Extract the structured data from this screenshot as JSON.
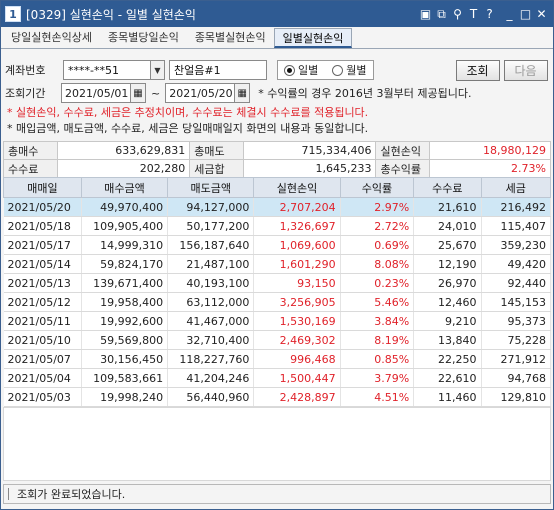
{
  "window": {
    "num": "1",
    "title": "[0329] 실현손익 - 일별 실현손익",
    "icons": [
      "window-icon",
      "copy-icon",
      "pin-icon",
      "font-size-icon",
      "help-icon",
      "minimize-icon",
      "maximize-icon",
      "close-icon"
    ],
    "icon_glyphs": [
      "▣",
      "⧉",
      "⚲",
      "T",
      "?",
      "_",
      "□",
      "✕"
    ]
  },
  "tabs": [
    {
      "label": "당일실현손익상세",
      "active": false
    },
    {
      "label": "종목별당일손익",
      "active": false
    },
    {
      "label": "종목별실현손익",
      "active": false
    },
    {
      "label": "일별실현손익",
      "active": true
    }
  ],
  "controls": {
    "account_label": "계좌번호",
    "account_value": "****-**51",
    "account_name": "찬얼음#1",
    "radio_daily": "일별",
    "radio_monthly": "월별",
    "radio_selected": "daily",
    "query_button": "조회",
    "next_button": "다음",
    "period_label": "조회기간",
    "date_from": "2021/05/01",
    "tilde": "~",
    "date_to": "2021/05/20",
    "period_note": "* 수익률의 경우 2016년 3월부터 제공됩니다."
  },
  "notes": {
    "red": "* 실현손익, 수수료, 세금은 추정치이며, 수수료는 체결시 수수료를 적용됩니다.",
    "black": "* 매입금액, 매도금액, 수수료, 세금은 당일매매일지 화면의 내용과 동일합니다."
  },
  "summary": {
    "row1": [
      {
        "key": "총매수",
        "value": "633,629,831"
      },
      {
        "key": "총매도",
        "value": "715,334,406"
      },
      {
        "key": "실현손익",
        "value": "18,980,129",
        "color": "#e0222a"
      }
    ],
    "row2": [
      {
        "key": "수수료",
        "value": "202,280"
      },
      {
        "key": "세금합",
        "value": "1,645,233"
      },
      {
        "key": "총수익률",
        "value": "2.73%",
        "color": "#e0222a"
      }
    ]
  },
  "table": {
    "headers": [
      "매매일",
      "매수금액",
      "매도금액",
      "실현손익",
      "수익률",
      "수수료",
      "세금"
    ],
    "rows": [
      [
        "2021/05/20",
        "49,970,400",
        "94,127,000",
        "2,707,204",
        "2.97%",
        "21,610",
        "216,492"
      ],
      [
        "2021/05/18",
        "109,905,400",
        "50,177,200",
        "1,326,697",
        "2.72%",
        "24,010",
        "115,407"
      ],
      [
        "2021/05/17",
        "14,999,310",
        "156,187,640",
        "1,069,600",
        "0.69%",
        "25,670",
        "359,230"
      ],
      [
        "2021/05/14",
        "59,824,170",
        "21,487,100",
        "1,601,290",
        "8.08%",
        "12,190",
        "49,420"
      ],
      [
        "2021/05/13",
        "139,671,400",
        "40,193,100",
        "93,150",
        "0.23%",
        "26,970",
        "92,440"
      ],
      [
        "2021/05/12",
        "19,958,400",
        "63,112,000",
        "3,256,905",
        "5.46%",
        "12,460",
        "145,153"
      ],
      [
        "2021/05/11",
        "19,992,600",
        "41,467,000",
        "1,530,169",
        "3.84%",
        "9,210",
        "95,373"
      ],
      [
        "2021/05/10",
        "59,569,800",
        "32,710,400",
        "2,469,302",
        "8.19%",
        "13,840",
        "75,228"
      ],
      [
        "2021/05/07",
        "30,156,450",
        "118,227,760",
        "996,468",
        "0.85%",
        "22,250",
        "271,912"
      ],
      [
        "2021/05/04",
        "109,583,661",
        "41,204,246",
        "1,500,447",
        "3.79%",
        "22,610",
        "94,768"
      ],
      [
        "2021/05/03",
        "19,998,240",
        "56,440,960",
        "2,428,897",
        "4.51%",
        "11,460",
        "129,810"
      ]
    ],
    "selected_row": 0,
    "profit_color": "#e0222a"
  },
  "status": {
    "message": "조회가 완료되었습니다."
  }
}
